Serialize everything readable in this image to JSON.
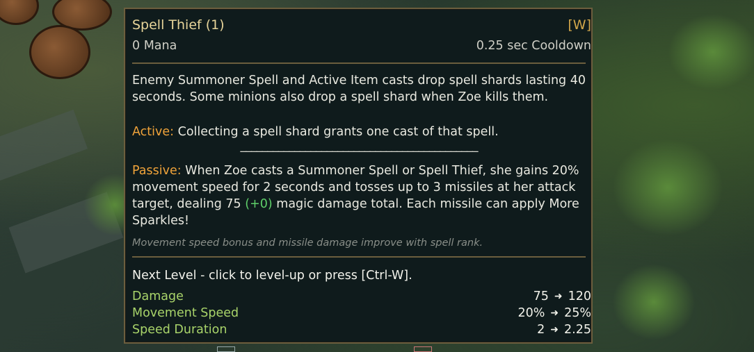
{
  "tooltip": {
    "title": "Spell Thief (1)",
    "hotkey": "[W]",
    "cost": "0 Mana",
    "cooldown": "0.25 sec Cooldown",
    "description": "Enemy Summoner Spell and Active Item casts drop spell shards lasting 40 seconds. Some minions also drop a spell shard when Zoe kills them.",
    "active_label": "Active:",
    "active_text": " Collecting a spell shard grants one cast of that spell.",
    "divider_text": "____________________________________________",
    "passive_label": "Passive:",
    "passive_text_1": " When Zoe casts a Summoner Spell or Spell Thief, she gains 20% movement speed for 2 seconds and tosses up to 3 missiles at her attack target, dealing 75 ",
    "passive_scaling": "(+0)",
    "passive_text_2": " magic damage total. Each missile can apply More Sparkles!",
    "note": "Movement speed bonus and missile damage improve with spell rank.",
    "next_level": "Next Level - click to level-up or press [Ctrl-W].",
    "stats": [
      {
        "name": "Damage",
        "from": "75",
        "to": "120"
      },
      {
        "name": "Movement Speed",
        "from": "20%",
        "to": "25%"
      },
      {
        "name": "Speed Duration",
        "from": "2",
        "to": "2.25"
      }
    ],
    "arrow_icon": "arrow-right-icon",
    "colors": {
      "title": "#e8d59a",
      "hotkey": "#d1a64a",
      "active_passive": "#f0a33a",
      "scaling": "#5fd06a",
      "stat_name": "#a9d46a",
      "border": "#6c5e3e",
      "background": "#0f1b1c"
    }
  }
}
